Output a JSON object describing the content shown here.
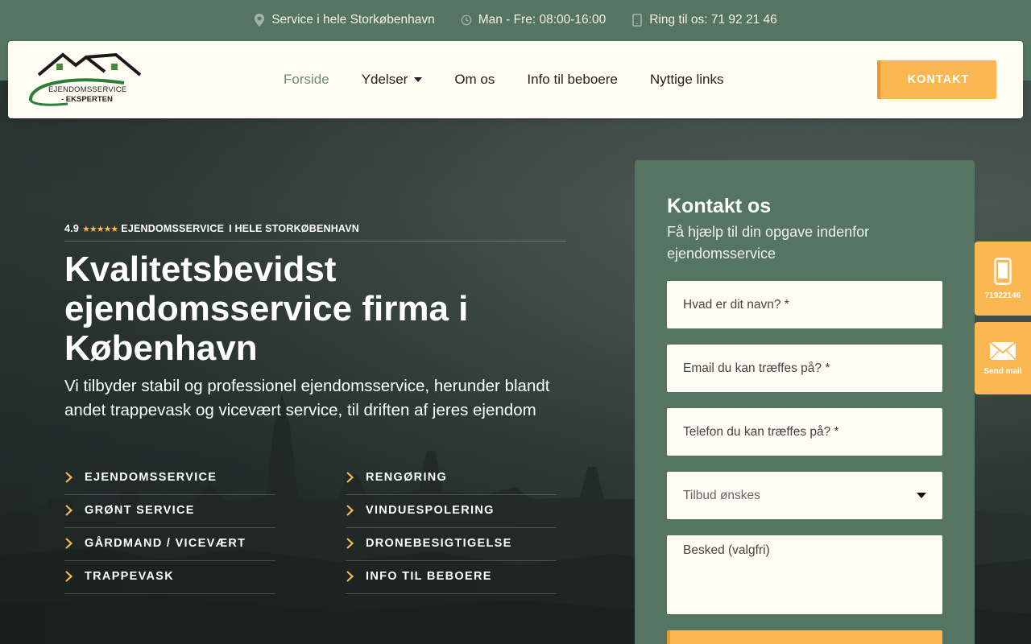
{
  "topbar": {
    "service_area": "Service i hele Storkøbenhavn",
    "hours": "Man - Fre: 08:00-16:00",
    "phone": "Ring til os: 71 92 21 46"
  },
  "logo": {
    "line1": "EJENDOMSSERVICE",
    "line2": "- EKSPERTEN"
  },
  "nav": {
    "items": [
      {
        "label": "Forside"
      },
      {
        "label": "Ydelser"
      },
      {
        "label": "Om os"
      },
      {
        "label": "Info til beboere"
      },
      {
        "label": "Nyttige links"
      }
    ],
    "cta": "KONTAKT"
  },
  "hero": {
    "rating": "4.9",
    "stars": "★★★★★",
    "rating_text": "EJENDOMSSERVICE",
    "rating_text2": "I HELE STORKØBENHAVN",
    "title": "Kvalitetsbevidst ejendomsservice firma i København",
    "subtitle": "Vi tilbyder stabil og professionel ejendomsservice, herunder blandt andet trappevask og vicevært service, til driften af jeres ejendom",
    "services_left": [
      "EJENDOMSSERVICE",
      "GRØNT SERVICE",
      "GÅRDMAND / VICEVÆRT",
      "TRAPPEVASK"
    ],
    "services_right": [
      "RENGØRING",
      "VINDUESPOLERING",
      "DRONEBESIGTIGELSE",
      "INFO TIL BEBOERE"
    ]
  },
  "form": {
    "title": "Kontakt os",
    "subtitle": "Få hjælp til din opgave indenfor ejendomsservice",
    "name_placeholder": "Hvad er dit navn? *",
    "email_placeholder": "Email du kan træffes på? *",
    "phone_placeholder": "Telefon du kan træffes på? *",
    "select_value": "Tilbud ønskes",
    "message_placeholder": "Besked (valgfri)"
  },
  "side": {
    "phone_label": "71922146",
    "mail_label": "Send mail"
  },
  "colors": {
    "green": "#557462",
    "accent": "#fbb751",
    "cream": "#fffcf4"
  }
}
